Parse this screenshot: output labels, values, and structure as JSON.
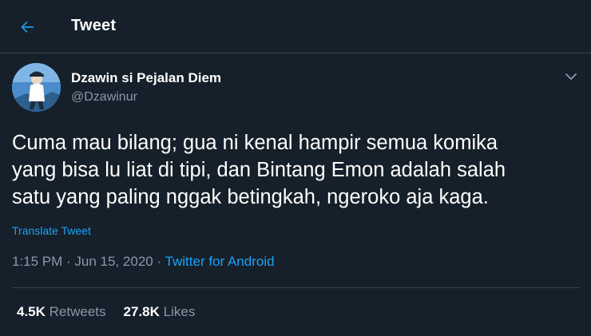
{
  "header": {
    "title": "Tweet"
  },
  "author": {
    "display_name": "Dzawin si Pejalan Diem",
    "handle": "@Dzawinur"
  },
  "tweet": {
    "text": "Cuma mau bilang; gua ni kenal hampir semua komika\nyang bisa lu liat di tipi, dan Bintang Emon adalah salah\nsatu yang paling nggak betingkah, ngeroko aja kaga.",
    "translate_label": "Translate Tweet"
  },
  "meta": {
    "time": "1:15 PM",
    "separator": " · ",
    "date": "Jun 15, 2020",
    "source": "Twitter for Android"
  },
  "stats": {
    "retweets_count": "4.5K",
    "retweets_label": "Retweets",
    "likes_count": "27.8K",
    "likes_label": "Likes"
  },
  "colors": {
    "background": "#15202b",
    "accent": "#1da1f2",
    "muted": "#8899a6",
    "border": "#38444d"
  },
  "icons": {
    "back": "arrow-left-icon",
    "caret": "chevron-down-icon"
  }
}
